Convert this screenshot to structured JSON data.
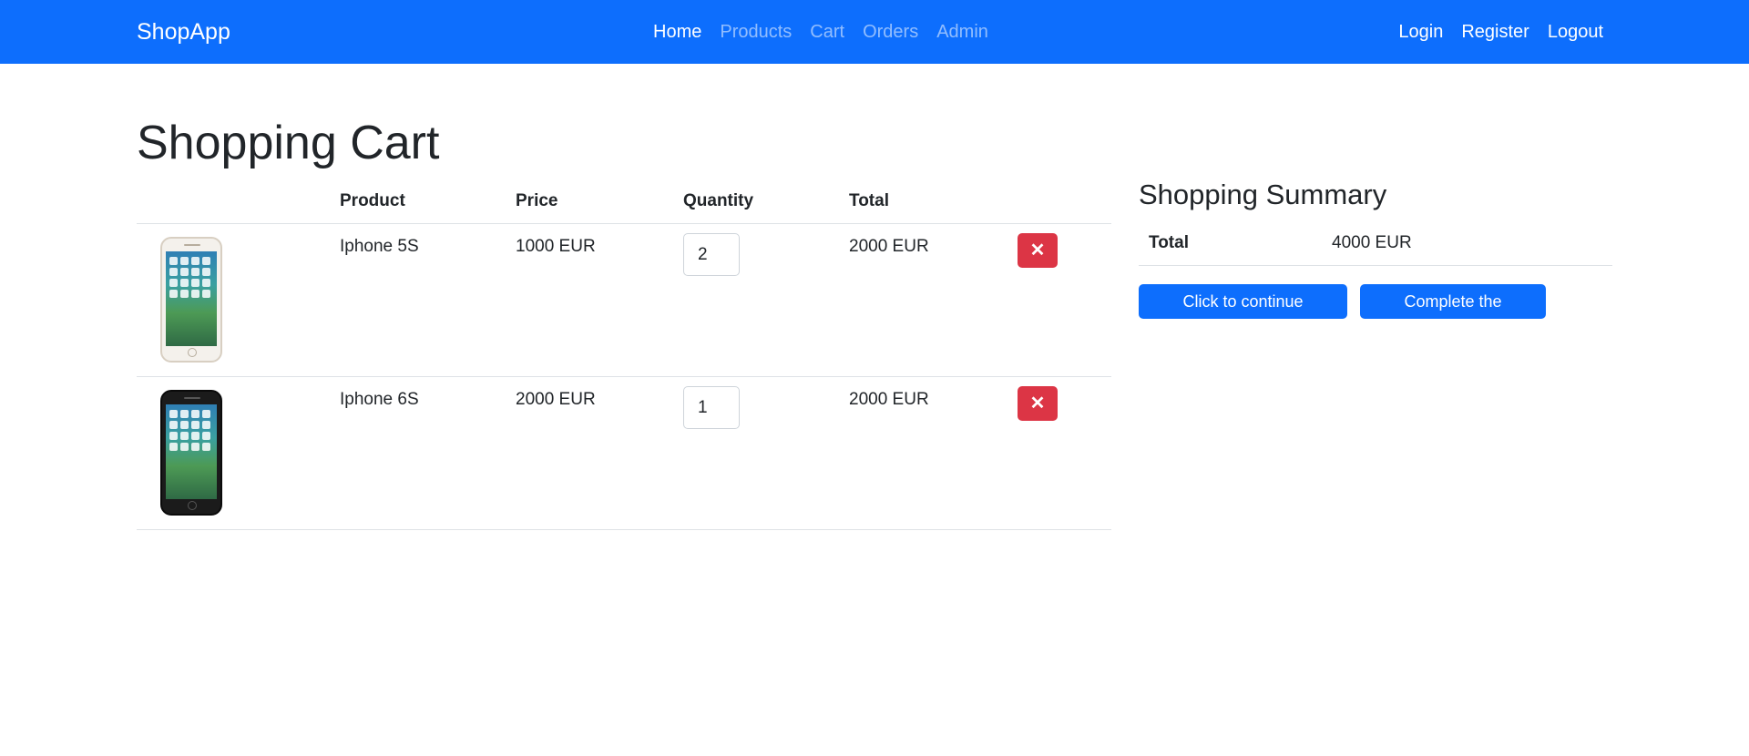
{
  "navbar": {
    "brand": "ShopApp",
    "links": [
      "Home",
      "Products",
      "Cart",
      "Orders",
      "Admin"
    ],
    "auth": [
      "Login",
      "Register",
      "Logout"
    ],
    "color": "#0d6efd"
  },
  "page_title": "Shopping Cart",
  "cart": {
    "headers": [
      "Product",
      "Price",
      "Quantity",
      "Total"
    ],
    "rows": [
      {
        "product": "Iphone 5S",
        "price": "1000 EUR",
        "quantity": "2",
        "total": "2000 EUR",
        "image": "iphone-white-icon"
      },
      {
        "product": "Iphone 6S",
        "price": "2000 EUR",
        "quantity": "1",
        "total": "2000 EUR",
        "image": "iphone-black-icon"
      }
    ],
    "remove_label": "✕"
  },
  "summary": {
    "title": "Shopping Summary",
    "total_label": "Total",
    "total_value": "4000 EUR",
    "continue_label": "Click to continue shopping",
    "complete_label": "Complete the shopping"
  },
  "colors": {
    "primary": "#0d6efd",
    "danger": "#dc3545"
  }
}
